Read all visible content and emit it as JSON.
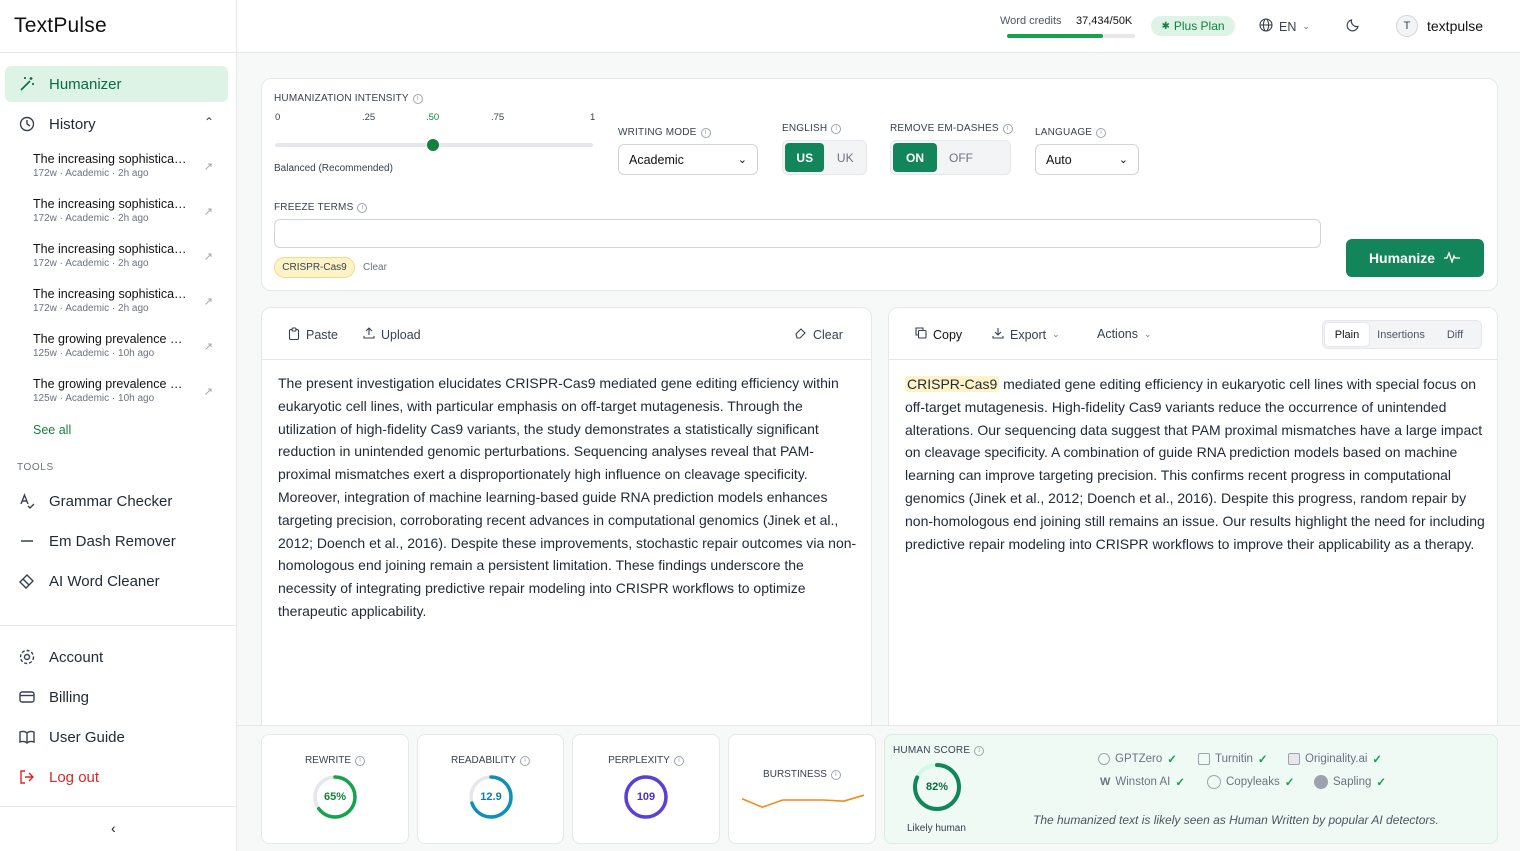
{
  "brand": {
    "logo": "TextPulse"
  },
  "sidebar": {
    "humanizer": "Humanizer",
    "history": "History",
    "history_items": [
      {
        "title": "The increasing sophisticati...",
        "meta": "172w · Academic · 2h ago"
      },
      {
        "title": "The increasing sophisticati...",
        "meta": "172w · Academic · 2h ago"
      },
      {
        "title": "The increasing sophisticati...",
        "meta": "172w · Academic · 2h ago"
      },
      {
        "title": "The increasing sophisticati...",
        "meta": "172w · Academic · 2h ago"
      },
      {
        "title": "The growing prevalence of ...",
        "meta": "125w · Academic · 10h ago"
      },
      {
        "title": "The growing prevalence of ...",
        "meta": "125w · Academic · 10h ago"
      }
    ],
    "see_all": "See all",
    "tools_heading": "TOOLS",
    "tools": [
      "Grammar Checker",
      "Em Dash Remover",
      "AI Word Cleaner"
    ],
    "account": "Account",
    "billing": "Billing",
    "user_guide": "User Guide",
    "logout": "Log out"
  },
  "topbar": {
    "credits_label": "Word credits",
    "credits_value": "37,434/50K",
    "credits_fraction": 0.75,
    "plan": "Plus Plan",
    "lang": "EN",
    "user_initial": "T",
    "username": "textpulse"
  },
  "settings": {
    "intensity_label": "HUMANIZATION INTENSITY",
    "ticks": [
      "0",
      ".25",
      ".50",
      ".75",
      "1"
    ],
    "intensity_value": 0.5,
    "intensity_desc": "Balanced (Recommended)",
    "writing_mode_label": "WRITING MODE",
    "writing_mode": "Academic",
    "english_label": "ENGLISH",
    "english_options": [
      "US",
      "UK"
    ],
    "emdash_label": "REMOVE EM-DASHES",
    "emdash_options": [
      "ON",
      "OFF"
    ],
    "language_label": "LANGUAGE",
    "language": "Auto",
    "freeze_label": "FREEZE TERMS",
    "freeze_chip": "CRISPR-Cas9",
    "freeze_clear": "Clear",
    "humanize_button": "Humanize"
  },
  "input": {
    "paste": "Paste",
    "upload": "Upload",
    "clear": "Clear",
    "text": "The present investigation elucidates CRISPR-Cas9 mediated gene editing efficiency within eukaryotic cell lines, with particular emphasis on off-target mutagenesis. Through the utilization of high-fidelity Cas9 variants, the study demonstrates a statistically significant reduction in unintended genomic perturbations. Sequencing analyses reveal that PAM-proximal mismatches exert a disproportionately high influence on cleavage specificity. Moreover, integration of machine learning-based guide RNA prediction models enhances targeting precision, corroborating recent advances in computational genomics (Jinek et al., 2012; Doench et al., 2016). Despite these improvements, stochastic repair outcomes via non-homologous end joining remain a persistent limitation. These findings underscore the necessity of integrating predictive repair modeling into CRISPR workflows to optimize therapeutic applicability."
  },
  "output": {
    "copy": "Copy",
    "export": "Export",
    "actions": "Actions",
    "views": [
      "Plain",
      "Insertions",
      "Diff"
    ],
    "highlight": "CRISPR-Cas9",
    "text": " mediated gene editing efficiency in eukaryotic cell lines with special focus on off-target mutagenesis. High-fidelity Cas9 variants reduce the occurrence of unintended alterations. Our sequencing data suggest that PAM proximal mismatches have a large impact on cleavage specificity. A combination of guide RNA prediction models based on machine learning can improve targeting precision. This confirms recent progress in computational genomics (Jinek et al., 2012; Doench et al., 2016). Despite this progress, random repair by non-homologous end joining still remains an issue. Our results highlight the need for including predictive repair modeling into CRISPR workflows to improve their applicability as a therapy."
  },
  "metrics": {
    "rewrite": {
      "label": "REWRITE",
      "value": "65%",
      "fraction": 0.65,
      "color": "#16a34a"
    },
    "readability": {
      "label": "READABILITY",
      "value": "12.9",
      "fraction": 0.7,
      "color": "#0e90b8"
    },
    "perplexity": {
      "label": "PERPLEXITY",
      "value": "109",
      "fraction": 1.0,
      "color": "#5b3fd6"
    },
    "burstiness": {
      "label": "BURSTINESS",
      "points": [
        0.55,
        0.2,
        0.5,
        0.5,
        0.5,
        0.45,
        0.7
      ],
      "color": "#f08a1c"
    }
  },
  "human_score": {
    "label": "HUMAN SCORE",
    "value": "82%",
    "fraction": 0.82,
    "verdict": "Likely human",
    "detectors_row1": [
      "GPTZero",
      "Turnitin",
      "Originality.ai"
    ],
    "detectors_row2": [
      "Winston AI",
      "Copyleaks",
      "Sapling"
    ],
    "note": "The humanized text is likely seen as Human Written by popular AI detectors."
  }
}
